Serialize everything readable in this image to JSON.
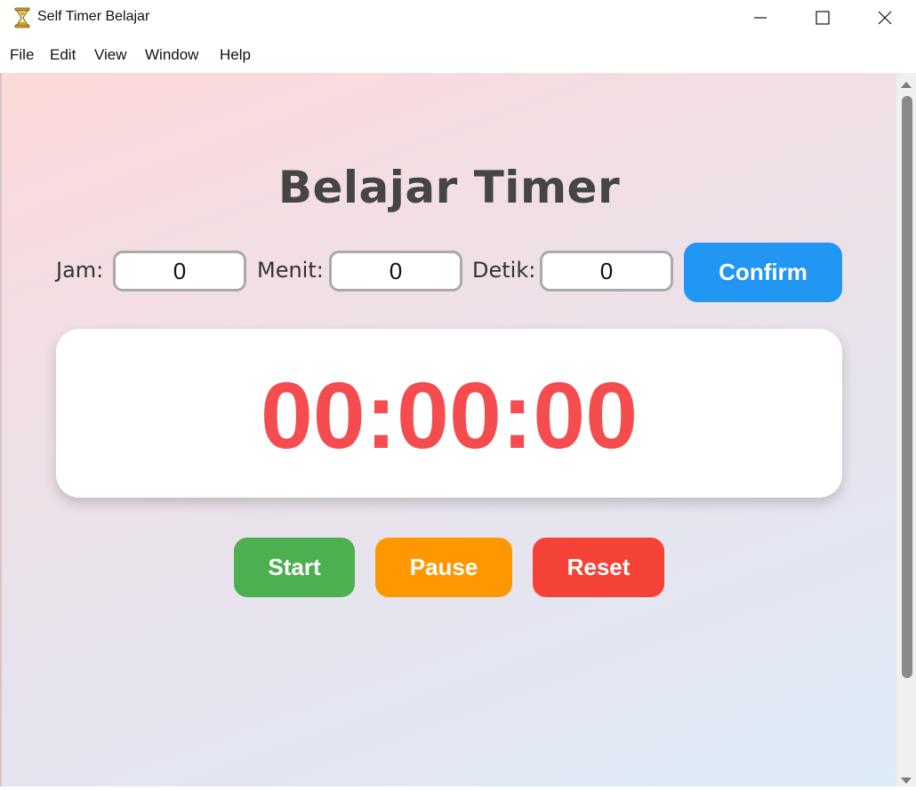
{
  "window": {
    "title": "Self Timer Belajar",
    "icon": "hourglass-icon",
    "controls": [
      "minimize-icon",
      "maximize-icon",
      "close-icon"
    ]
  },
  "menu": {
    "items": [
      {
        "label": "File"
      },
      {
        "label": "Edit"
      },
      {
        "label": "View"
      },
      {
        "label": "Window"
      },
      {
        "label": "Help"
      }
    ]
  },
  "main": {
    "heading": "Belajar Timer",
    "fields": [
      {
        "label": "Jam:",
        "value": "0"
      },
      {
        "label": "Menit:",
        "value": "0"
      },
      {
        "label": "Detik:",
        "value": "0"
      }
    ],
    "confirm_label": "Confirm",
    "display": "00:00:00",
    "start_label": "Start",
    "pause_label": "Pause",
    "reset_label": "Reset"
  },
  "colors": {
    "confirm": "#2196f3",
    "start": "#4caf50",
    "pause": "#ff9800",
    "reset": "#f44336",
    "display_text": "#f44c4f",
    "heading_text": "#454545"
  }
}
